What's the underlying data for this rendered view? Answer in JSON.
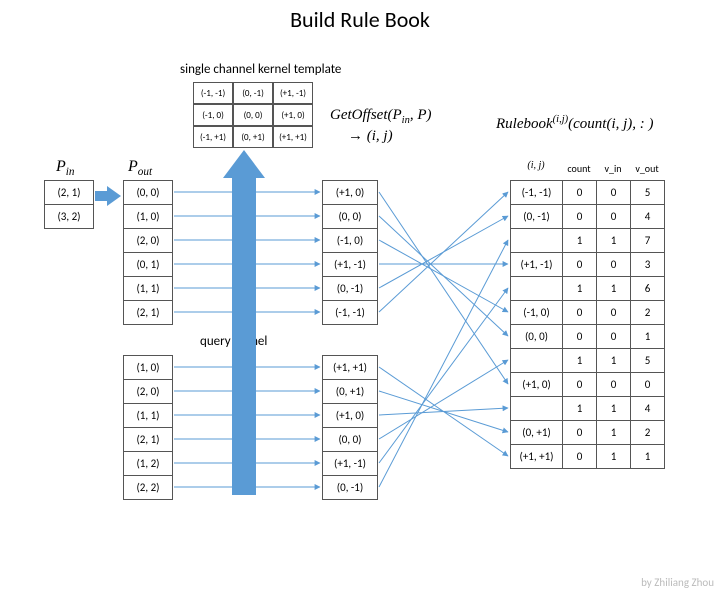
{
  "title": "Build Rule Book",
  "labels": {
    "kernel_template": "single channel kernel template",
    "pin": "P_in",
    "pout": "P_out",
    "get_offset_l1": "GetOffset(P_in, P)",
    "get_offset_l2": "→ (i, j)",
    "rulebook": "Rulebook^(i,j)(count(i, j), :)",
    "query_kernel": "query Kernel",
    "rb_ij": "(i, j)",
    "rb_count": "count",
    "rb_vin": "v_in",
    "rb_vout": "v_out"
  },
  "pin": [
    "(2, 1)",
    "(3, 2)"
  ],
  "pout_top": [
    "(0, 0)",
    "(1, 0)",
    "(2, 0)",
    "(0, 1)",
    "(1, 1)",
    "(2, 1)"
  ],
  "pout_bot": [
    "(1, 0)",
    "(2, 0)",
    "(1, 1)",
    "(2, 1)",
    "(1, 2)",
    "(2, 2)"
  ],
  "kernel": [
    "(-1, -1)",
    "(0, -1)",
    "(+1, -1)",
    "(-1, 0)",
    "(0, 0)",
    "(+1, 0)",
    "(-1, +1)",
    "(0, +1)",
    "(+1, +1)"
  ],
  "offset_top": [
    "(+1, 0)",
    "(0, 0)",
    "(-1, 0)",
    "(+1, -1)",
    "(0, -1)",
    "(-1, -1)"
  ],
  "offset_bot": [
    "(+1, +1)",
    "(0, +1)",
    "(+1, 0)",
    "(0, 0)",
    "(+1, -1)",
    "(0, -1)"
  ],
  "rulebook": [
    {
      "ij": "(-1, -1)",
      "count": "0",
      "vin": "0",
      "vout": "5"
    },
    {
      "ij": "(0, -1)",
      "count": "0",
      "vin": "0",
      "vout": "4"
    },
    {
      "ij": "",
      "count": "1",
      "vin": "1",
      "vout": "7"
    },
    {
      "ij": "(+1, -1)",
      "count": "0",
      "vin": "0",
      "vout": "3"
    },
    {
      "ij": "",
      "count": "1",
      "vin": "1",
      "vout": "6"
    },
    {
      "ij": "(-1, 0)",
      "count": "0",
      "vin": "0",
      "vout": "2"
    },
    {
      "ij": "(0, 0)",
      "count": "0",
      "vin": "0",
      "vout": "1"
    },
    {
      "ij": "",
      "count": "1",
      "vin": "1",
      "vout": "5"
    },
    {
      "ij": "(+1, 0)",
      "count": "0",
      "vin": "0",
      "vout": "0"
    },
    {
      "ij": "",
      "count": "1",
      "vin": "1",
      "vout": "4"
    },
    {
      "ij": "(0, +1)",
      "count": "0",
      "vin": "1",
      "vout": "2"
    },
    {
      "ij": "(+1, +1)",
      "count": "0",
      "vin": "1",
      "vout": "1"
    }
  ],
  "credit": "by Zhiliang Zhou"
}
